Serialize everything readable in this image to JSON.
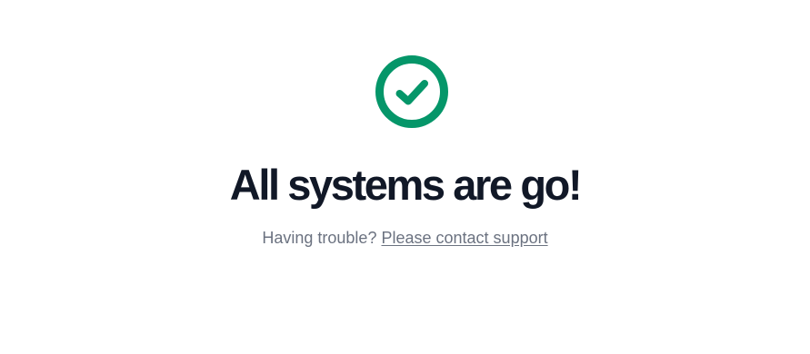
{
  "status": {
    "icon": "check-circle-icon",
    "icon_color": "#059669",
    "headline": "All systems are go!",
    "headline_color": "#111827"
  },
  "support": {
    "prompt": "Having trouble?",
    "link_label": "Please contact support",
    "text_color": "#6b7280"
  }
}
